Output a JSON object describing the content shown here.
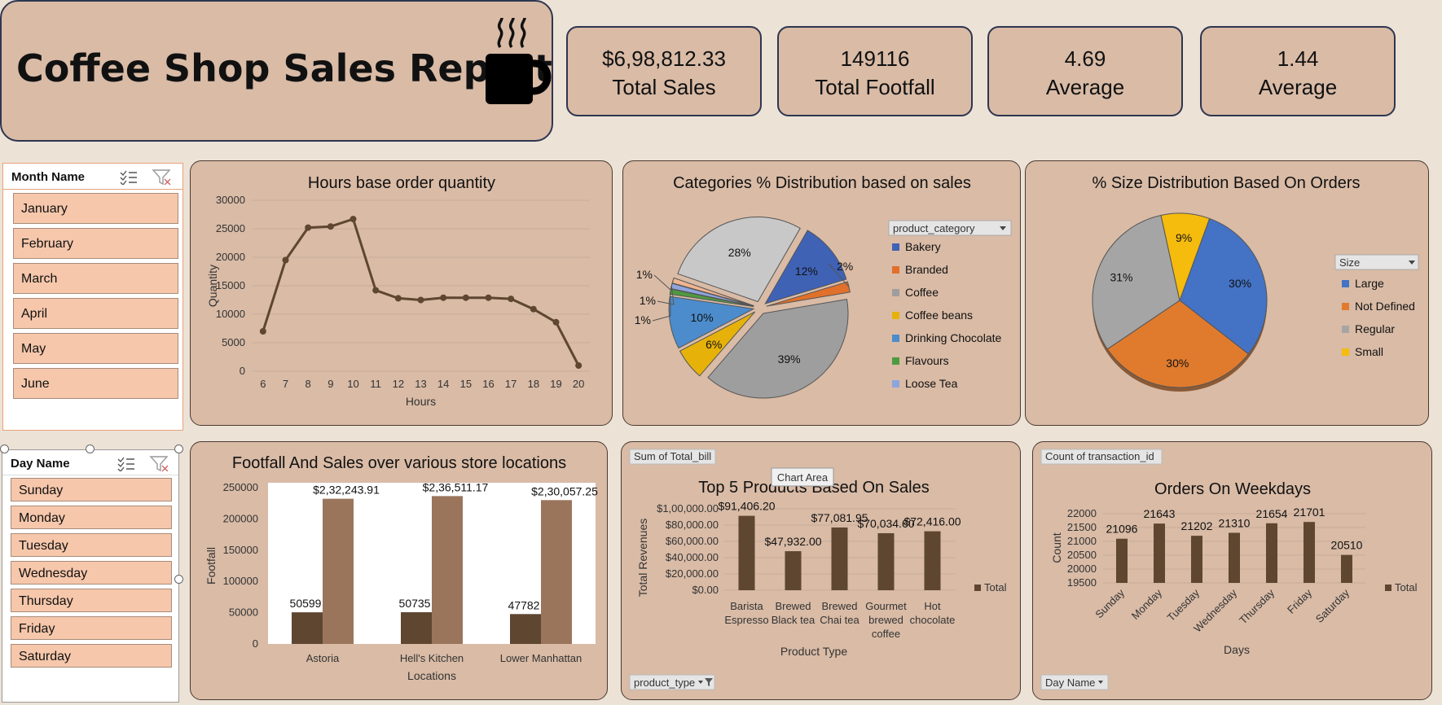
{
  "header": {
    "title": "Coffee Shop Sales Report",
    "cup_icon": "coffee-cup-icon"
  },
  "kpis": [
    {
      "value": "$6,98,812.33",
      "label": "Total Sales"
    },
    {
      "value": "149116",
      "label": "Total Footfall"
    },
    {
      "value": "4.69",
      "label": "Average"
    },
    {
      "value": "1.44",
      "label": "Average"
    }
  ],
  "slicers": {
    "month": {
      "title": "Month Name",
      "items": [
        "January",
        "February",
        "March",
        "April",
        "May",
        "June"
      ]
    },
    "day": {
      "title": "Day Name",
      "items": [
        "Sunday",
        "Monday",
        "Tuesday",
        "Wednesday",
        "Thursday",
        "Friday",
        "Saturday"
      ]
    }
  },
  "colors": {
    "background": "#ede2d6",
    "panel": "#d9bba6",
    "slicer_item": "#f6c7ab",
    "dark_brown": "#5e4631",
    "light_brown": "#9a755c"
  },
  "chart_data": [
    {
      "type": "line",
      "title": "Hours base order quantity",
      "xlabel": "Hours",
      "ylabel": "Quantity",
      "x": [
        6,
        7,
        8,
        9,
        10,
        11,
        12,
        13,
        14,
        15,
        16,
        17,
        18,
        19,
        20
      ],
      "values": [
        7000,
        19500,
        25200,
        25400,
        26700,
        14200,
        12800,
        12500,
        12900,
        12900,
        12900,
        12700,
        10900,
        8600,
        1000
      ],
      "yticks": [
        "0",
        "5000",
        "10000",
        "15000",
        "20000",
        "25000",
        "30000"
      ],
      "ylim": [
        0,
        30000
      ],
      "grid": true,
      "color": "#5e4631"
    },
    {
      "type": "pie",
      "title": "Categories % Distribution based on sales",
      "legend_title": "product_category",
      "legend_position": "right",
      "slices": [
        {
          "name": "Bakery",
          "value": 12,
          "label": "12%",
          "color": "#3f62b5"
        },
        {
          "name": "Branded",
          "value": 2,
          "label": "2%",
          "color": "#e0702a"
        },
        {
          "name": "Coffee",
          "value": 39,
          "label": "39%",
          "color": "#9e9e9e"
        },
        {
          "name": "Coffee beans",
          "value": 6,
          "label": "6%",
          "color": "#e6b20a"
        },
        {
          "name": "Drinking Chocolate",
          "value": 10,
          "label": "10%",
          "color": "#4c8ccc"
        },
        {
          "name": "Flavours",
          "value": 1,
          "label": "1%",
          "color": "#4e9a40"
        },
        {
          "name": "Loose Tea",
          "value": 1,
          "label": "1%",
          "color": "#8ea4de"
        },
        {
          "name": "",
          "value": 1,
          "label": "1%",
          "color": "#f0b48f"
        },
        {
          "name": "",
          "value": 28,
          "label": "28%",
          "color": "#c8c8c8"
        }
      ]
    },
    {
      "type": "pie",
      "title": "% Size Distribution Based On Orders",
      "legend_title": "Size",
      "legend_position": "right",
      "slices": [
        {
          "name": "Large",
          "value": 30,
          "label": "30%",
          "color": "#4472c4"
        },
        {
          "name": "Not Defined",
          "value": 30,
          "label": "30%",
          "color": "#e07b2e"
        },
        {
          "name": "Regular",
          "value": 31,
          "label": "31%",
          "color": "#a5a5a5"
        },
        {
          "name": "Small",
          "value": 9,
          "label": "9%",
          "color": "#f5bb0d"
        }
      ]
    },
    {
      "type": "bar",
      "title": "Footfall And Sales over various store locations",
      "xlabel": "Locations",
      "ylabel": "Footfall",
      "categories": [
        "Astoria",
        "Hell's Kitchen",
        "Lower Manhattan"
      ],
      "series": [
        {
          "values": [
            50599,
            50735,
            47782
          ],
          "labels": [
            "50599",
            "50735",
            "47782"
          ],
          "color": "#5e4631"
        },
        {
          "values": [
            232243.91,
            236511.17,
            230057.25
          ],
          "labels": [
            "$2,32,243.91",
            "$2,36,511.17",
            "$2,30,057.25"
          ],
          "color": "#9a755c"
        }
      ],
      "yticks": [
        "0",
        "50000",
        "100000",
        "150000",
        "200000",
        "250000"
      ],
      "ylim": [
        0,
        250000
      ]
    },
    {
      "type": "bar",
      "title": "Top 5 Products Based On Sales",
      "pivot_field": "Sum of Total_bill",
      "filter_field": "product_type",
      "tooltip": "Chart Area",
      "xlabel": "Product Type",
      "ylabel": "Total Revenues",
      "categories": [
        [
          "Barista",
          "Espresso"
        ],
        [
          "Brewed",
          "Black tea"
        ],
        [
          "Brewed",
          "Chai tea"
        ],
        [
          "Gourmet",
          "brewed",
          "coffee"
        ],
        [
          "Hot",
          "chocolate"
        ]
      ],
      "values": [
        91406.2,
        47932.0,
        77081.95,
        70034.6,
        72416.0
      ],
      "labels": [
        "$91,406.20",
        "$47,932.00",
        "$77,081.95",
        "$70,034.60",
        "$72,416.00"
      ],
      "yticks": [
        "$0.00",
        "$20,000.00",
        "$40,000.00",
        "$60,000.00",
        "$80,000.00",
        "$1,00,000.00"
      ],
      "ylim": [
        0,
        100000
      ],
      "legend": "Total",
      "color": "#5e4631"
    },
    {
      "type": "bar",
      "title": "Orders On Weekdays",
      "pivot_field": "Count of transaction_id",
      "filter_field": "Day Name",
      "xlabel": "Days",
      "ylabel": "Count",
      "categories": [
        "Sunday",
        "Monday",
        "Tuesday",
        "Wednesday",
        "Thursday",
        "Friday",
        "Saturday"
      ],
      "values": [
        21096,
        21643,
        21202,
        21310,
        21654,
        21701,
        20510
      ],
      "labels": [
        "21096",
        "21643",
        "21202",
        "21310",
        "21654",
        "21701",
        "20510"
      ],
      "yticks": [
        "19500",
        "20000",
        "20500",
        "21000",
        "21500",
        "22000"
      ],
      "ylim": [
        19500,
        22000
      ],
      "legend": "Total",
      "color": "#5e4631"
    }
  ]
}
